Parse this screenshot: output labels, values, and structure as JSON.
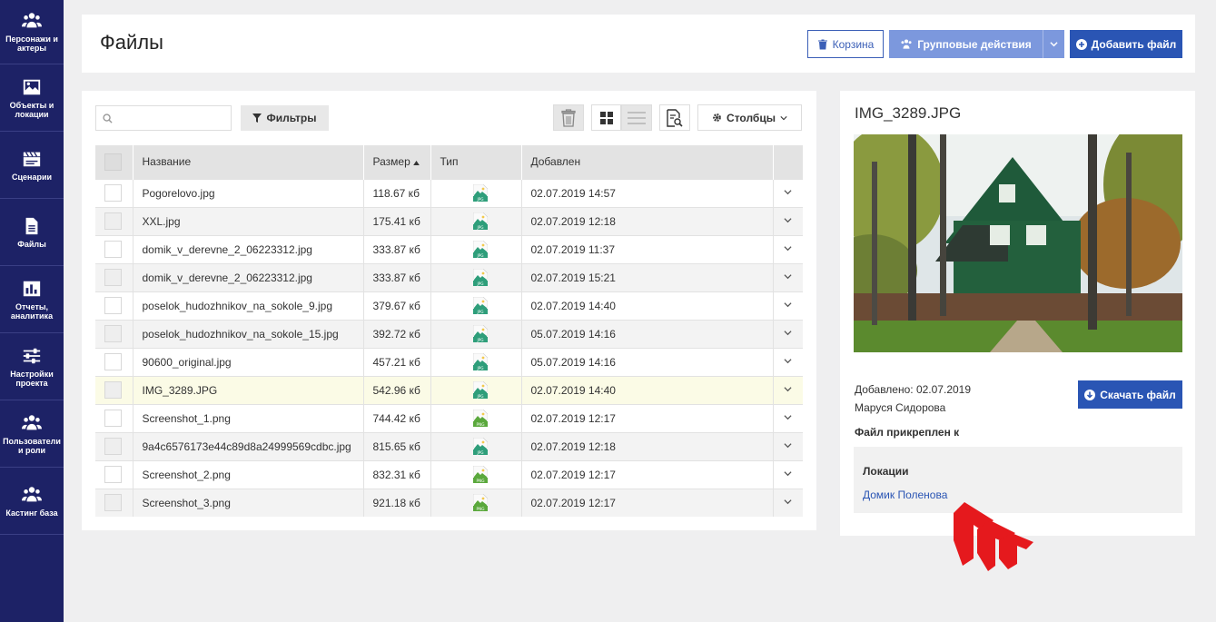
{
  "sidebar": {
    "items": [
      {
        "label": "Персонажи и актеры",
        "icon": "users-icon"
      },
      {
        "label": "Объекты и локации",
        "icon": "image-icon"
      },
      {
        "label": "Сценарии",
        "icon": "clapperboard-icon"
      },
      {
        "label": "Файлы",
        "icon": "file-icon"
      },
      {
        "label": "Отчеты, аналитика",
        "icon": "chart-icon"
      },
      {
        "label": "Настройки проекта",
        "icon": "sliders-icon"
      },
      {
        "label": "Пользователи и роли",
        "icon": "users-icon"
      },
      {
        "label": "Кастинг база",
        "icon": "users-icon"
      }
    ]
  },
  "header": {
    "title": "Файлы",
    "trash_label": "Корзина",
    "group_label": "Групповые действия",
    "add_label": "Добавить файл"
  },
  "toolbar": {
    "search_placeholder": "",
    "filter_label": "Фильтры",
    "columns_label": "Столбцы"
  },
  "table": {
    "headers": {
      "name": "Название",
      "size": "Размер",
      "type": "Тип",
      "added": "Добавлен"
    },
    "sort_column": "size",
    "rows": [
      {
        "name": "Pogorelovo.jpg",
        "size": "118.67 кб",
        "type": "JPG",
        "added": "02.07.2019 14:57"
      },
      {
        "name": "XXL.jpg",
        "size": "175.41 кб",
        "type": "JPG",
        "added": "02.07.2019 12:18"
      },
      {
        "name": "domik_v_derevne_2_06223312.jpg",
        "size": "333.87 кб",
        "type": "JPG",
        "added": "02.07.2019 11:37"
      },
      {
        "name": "domik_v_derevne_2_06223312.jpg",
        "size": "333.87 кб",
        "type": "JPG",
        "added": "02.07.2019 15:21"
      },
      {
        "name": "poselok_hudozhnikov_na_sokole_9.jpg",
        "size": "379.67 кб",
        "type": "JPG",
        "added": "02.07.2019 14:40"
      },
      {
        "name": "poselok_hudozhnikov_na_sokole_15.jpg",
        "size": "392.72 кб",
        "type": "JPG",
        "added": "05.07.2019 14:16"
      },
      {
        "name": "90600_original.jpg",
        "size": "457.21 кб",
        "type": "JPG",
        "added": "05.07.2019 14:16"
      },
      {
        "name": "IMG_3289.JPG",
        "size": "542.96 кб",
        "type": "JPG",
        "added": "02.07.2019 14:40",
        "selected": true
      },
      {
        "name": "Screenshot_1.png",
        "size": "744.42 кб",
        "type": "PNG",
        "added": "02.07.2019 12:17"
      },
      {
        "name": "9a4c6576173e44c89d8a24999569cdbc.jpg",
        "size": "815.65 кб",
        "type": "JPG",
        "added": "02.07.2019 12:18"
      },
      {
        "name": "Screenshot_2.png",
        "size": "832.31 кб",
        "type": "PNG",
        "added": "02.07.2019 12:17"
      },
      {
        "name": "Screenshot_3.png",
        "size": "921.18 кб",
        "type": "PNG",
        "added": "02.07.2019 12:17"
      }
    ]
  },
  "detail": {
    "filename": "IMG_3289.JPG",
    "added": "Добавлено: 02.07.2019",
    "author": "Маруся Сидорова",
    "download_label": "Скачать файл",
    "attached_title": "Файл прикреплен к",
    "locations_title": "Локации",
    "location_link": "Домик Поленова"
  },
  "colors": {
    "sidebar_bg": "#1d2266",
    "primary": "#2a55b4",
    "primary_light": "#7c98dd",
    "selected_row": "#fbfbe6",
    "accent_mark": "#e5191d"
  }
}
